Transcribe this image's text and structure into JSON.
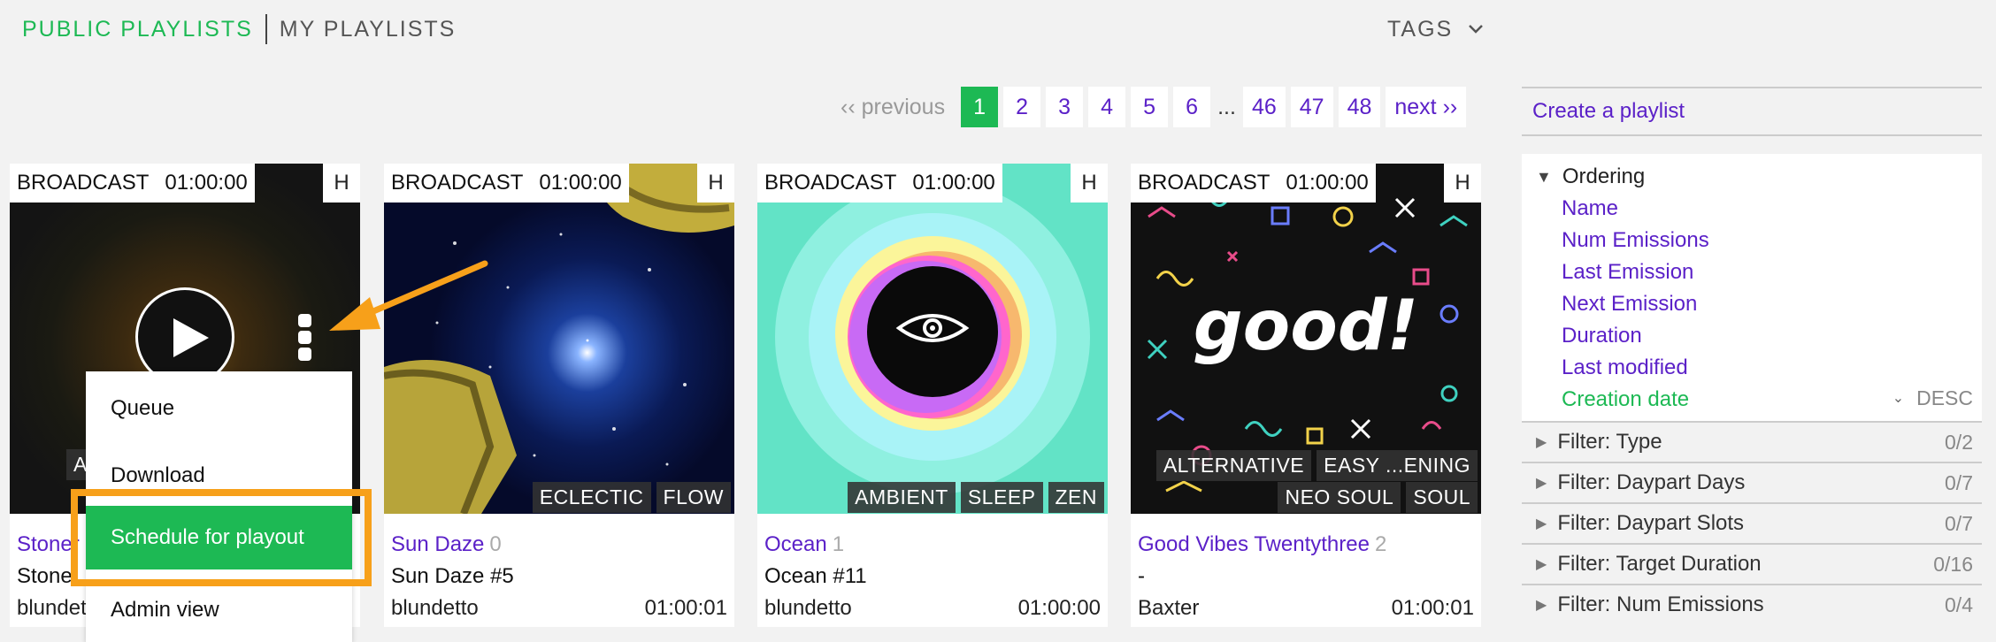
{
  "nav": {
    "public": "PUBLIC PLAYLISTS",
    "mine": "MY PLAYLISTS",
    "tags": "TAGS"
  },
  "pagination": {
    "previous": "‹‹ previous",
    "pages": [
      "1",
      "2",
      "3",
      "4",
      "5",
      "6"
    ],
    "ellipsis": "...",
    "last_pages": [
      "46",
      "47",
      "48"
    ],
    "next": "next ››",
    "current": "1"
  },
  "cards": [
    {
      "type": "BROADCAST",
      "time": "01:00:00",
      "badge": "H",
      "title": "Stoner",
      "count": "",
      "subtitle": "Stone",
      "owner": "blundetto",
      "duration": "",
      "tags_row1": [
        "AM"
      ],
      "tags_row2": []
    },
    {
      "type": "BROADCAST",
      "time": "01:00:00",
      "badge": "H",
      "title": "Sun Daze",
      "count": "0",
      "subtitle": "Sun Daze #5",
      "owner": "blundetto",
      "duration": "01:00:01",
      "tags_row1": [],
      "tags_row2": [
        "ECLECTIC",
        "FLOW"
      ]
    },
    {
      "type": "BROADCAST",
      "time": "01:00:00",
      "badge": "H",
      "title": "Ocean",
      "count": "1",
      "subtitle": "Ocean #11",
      "owner": "blundetto",
      "duration": "01:00:00",
      "tags_row1": [],
      "tags_row2": [
        "AMBIENT",
        "SLEEP",
        "ZEN"
      ]
    },
    {
      "type": "BROADCAST",
      "time": "01:00:00",
      "badge": "H",
      "title": "Good Vibes Twentythree",
      "count": "2",
      "subtitle": "-",
      "owner": "Baxter",
      "duration": "01:00:01",
      "tags_row1": [
        "ALTERNATIVE",
        "EASY ...ENING"
      ],
      "tags_row2": [
        "NEO SOUL",
        "SOUL"
      ]
    }
  ],
  "card4_art_text": "good!",
  "menu": {
    "items": [
      "Queue",
      "Download",
      "Schedule for playout",
      "Admin view"
    ],
    "active": "Schedule for playout"
  },
  "sidebar": {
    "create": "Create a playlist",
    "ordering": {
      "heading": "Ordering",
      "options": [
        "Name",
        "Num Emissions",
        "Last Emission",
        "Next Emission",
        "Duration",
        "Last modified",
        "Creation date"
      ],
      "selected": "Creation date",
      "direction": "DESC"
    },
    "filters": [
      {
        "label": "Filter: Type",
        "count": "0/2"
      },
      {
        "label": "Filter: Daypart Days",
        "count": "0/7"
      },
      {
        "label": "Filter: Daypart Slots",
        "count": "0/7"
      },
      {
        "label": "Filter: Target Duration",
        "count": "0/16"
      },
      {
        "label": "Filter: Num Emissions",
        "count": "0/4"
      }
    ]
  },
  "colors": {
    "accent_green": "#1db954",
    "link_purple": "#5b21c8",
    "highlight_orange": "#f7a01a"
  }
}
